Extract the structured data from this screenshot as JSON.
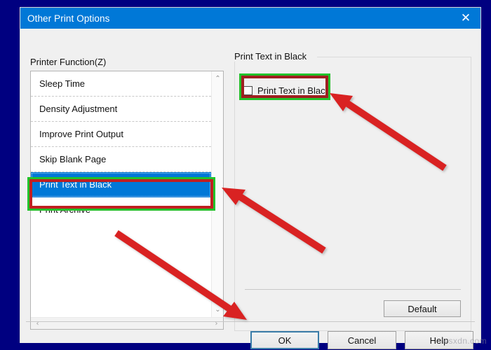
{
  "window": {
    "title": "Other Print Options",
    "close_icon": "close-icon"
  },
  "left_pane": {
    "label": "Printer Function(Z)",
    "items": [
      {
        "label": "Sleep Time",
        "selected": false
      },
      {
        "label": "Density Adjustment",
        "selected": false
      },
      {
        "label": "Improve Print Output",
        "selected": false
      },
      {
        "label": "Skip Blank Page",
        "selected": false
      },
      {
        "label": "Print Text in Black",
        "selected": true
      },
      {
        "label": "Print Archive",
        "selected": false
      }
    ],
    "scrollbar": {
      "up_icon": "chevron-up-icon",
      "down_icon": "chevron-down-icon",
      "left_icon": "chevron-left-icon",
      "right_icon": "chevron-right-icon",
      "up_glyph": "⌃",
      "down_glyph": "⌄",
      "left_glyph": "‹",
      "right_glyph": "›"
    }
  },
  "right_pane": {
    "group_label": "Print Text in Black",
    "checkbox": {
      "label": "Print Text in Black",
      "checked": false
    },
    "default_button": "Default"
  },
  "footer": {
    "ok": "OK",
    "cancel": "Cancel",
    "help": "Help"
  },
  "annotations": {
    "highlight_outer_color": "#22c32b",
    "highlight_inner_color": "#c02020",
    "arrow_color": "#d92020",
    "arrow_count": 3
  },
  "watermark": "wsxdn.com"
}
